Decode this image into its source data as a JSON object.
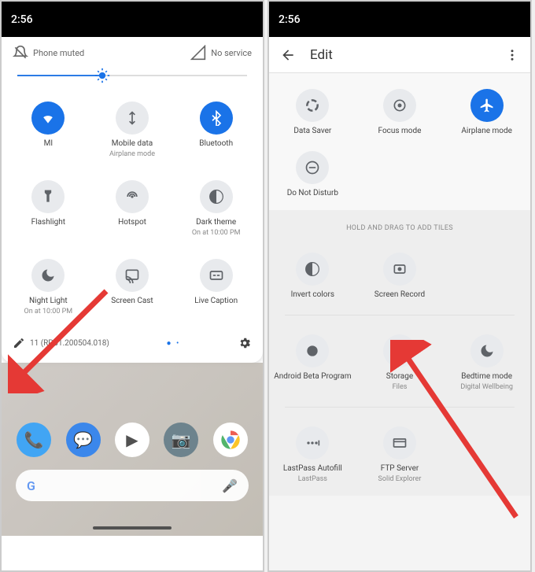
{
  "left": {
    "status_time": "2:56",
    "header_left": "Phone muted",
    "header_right": "No service",
    "brightness_pct": 37,
    "tiles": [
      {
        "icon": "wifi",
        "label": "MI",
        "sublabel": "",
        "on": true
      },
      {
        "icon": "data",
        "label": "Mobile data",
        "sublabel": "Airplane mode",
        "on": false
      },
      {
        "icon": "bluetooth",
        "label": "Bluetooth",
        "sublabel": "",
        "on": true
      },
      {
        "icon": "flashlight",
        "label": "Flashlight",
        "sublabel": "",
        "on": false
      },
      {
        "icon": "hotspot",
        "label": "Hotspot",
        "sublabel": "",
        "on": false
      },
      {
        "icon": "darktheme",
        "label": "Dark theme",
        "sublabel": "On at 10:00 PM",
        "on": false
      },
      {
        "icon": "nightlight",
        "label": "Night Light",
        "sublabel": "On at 10:00 PM",
        "on": false
      },
      {
        "icon": "cast",
        "label": "Screen Cast",
        "sublabel": "",
        "on": false
      },
      {
        "icon": "caption",
        "label": "Live Caption",
        "sublabel": "",
        "on": false
      }
    ],
    "version": "11 (RPB1.200504.018)"
  },
  "right": {
    "status_time": "2:56",
    "title": "Edit",
    "active_tiles": [
      {
        "icon": "datasaver",
        "label": "Data Saver",
        "on": false
      },
      {
        "icon": "focus",
        "label": "Focus mode",
        "on": false
      },
      {
        "icon": "airplane",
        "label": "Airplane mode",
        "on": true
      },
      {
        "icon": "dnd",
        "label": "Do Not Disturb",
        "on": false
      }
    ],
    "drag_hint": "HOLD AND DRAG TO ADD TILES",
    "available_tiles": [
      {
        "icon": "invert",
        "label": "Invert colors",
        "sublabel": ""
      },
      {
        "icon": "record",
        "label": "Screen Record",
        "sublabel": ""
      },
      {
        "icon": "spacer",
        "label": "",
        "sublabel": ""
      },
      {
        "icon": "beta",
        "label": "Android Beta Program",
        "sublabel": ""
      },
      {
        "icon": "storage",
        "label": "Storage",
        "sublabel": "Files"
      },
      {
        "icon": "bedtime",
        "label": "Bedtime mode",
        "sublabel": "Digital Wellbeing"
      },
      {
        "icon": "lastpass",
        "label": "LastPass Autofill",
        "sublabel": "LastPass"
      },
      {
        "icon": "ftp",
        "label": "FTP Server",
        "sublabel": "Solid Explorer"
      }
    ]
  }
}
